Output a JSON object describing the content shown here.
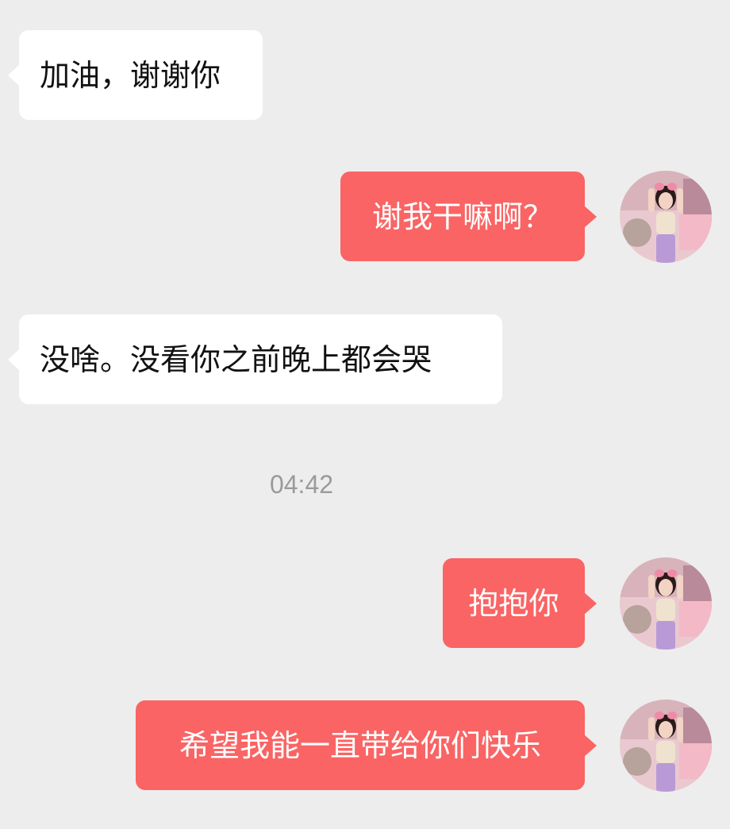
{
  "messages": [
    {
      "direction": "incoming",
      "text": "加油，谢谢你"
    },
    {
      "direction": "outgoing",
      "text": "谢我干嘛啊？",
      "avatar": "user-avatar"
    },
    {
      "direction": "incoming",
      "text": "没啥。没看你之前晚上都会哭"
    },
    {
      "direction": "outgoing",
      "text": "抱抱你",
      "avatar": "user-avatar"
    },
    {
      "direction": "outgoing",
      "text": "希望我能一直带给你们快乐",
      "avatar": "user-avatar"
    }
  ],
  "timestamp": "04:42",
  "colors": {
    "background": "#ededed",
    "incoming_bubble": "#ffffff",
    "outgoing_bubble": "#fa6464",
    "timestamp_text": "#9a9a9a"
  }
}
